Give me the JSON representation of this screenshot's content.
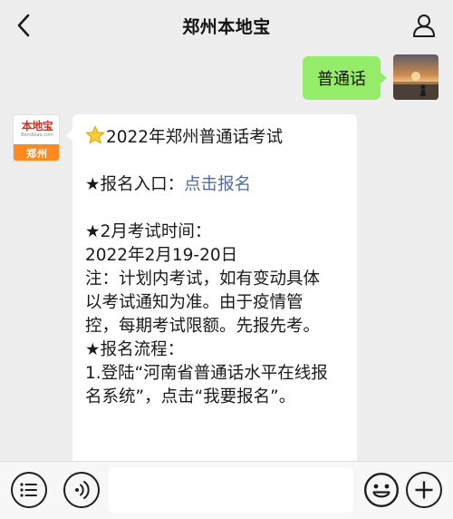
{
  "header": {
    "title": "郑州本地宝",
    "back_icon": "chevron-left-icon",
    "user_icon": "person-icon"
  },
  "outgoing": {
    "text": "普通话",
    "avatar_icon": "sunset-photo-avatar"
  },
  "incoming": {
    "avatar": {
      "brand_name": "本地宝",
      "domain": "Bendibao.com",
      "city": "郑州"
    },
    "star_icon": "star-emoji-icon",
    "headline": "2022年郑州普通话考试",
    "signup_prefix": "★报名入口：",
    "signup_link": "点击报名",
    "exam_time_label": "★2月考试时间：",
    "exam_date": "2022年2月19-20日",
    "note_lines": [
      "注：计划内考试，如有变动具体",
      "以考试通知为准。由于疫情管",
      "控，每期考试限额。先报先考。"
    ],
    "process_label": "★报名流程：",
    "step_lines": [
      "1.登陆“河南省普通话水平在线报",
      "名系统”，点击“我要报名”。"
    ]
  },
  "input_bar": {
    "menu_icon": "list-menu-icon",
    "voice_icon": "voice-icon",
    "input_value": "",
    "emoji_icon": "smiley-icon",
    "plus_icon": "plus-icon"
  },
  "colors": {
    "background": "#ededed",
    "outgoing_bubble": "#95ec69",
    "link": "#576b95",
    "brand_red": "#d62b1f",
    "brand_orange": "#ff8a1f"
  }
}
